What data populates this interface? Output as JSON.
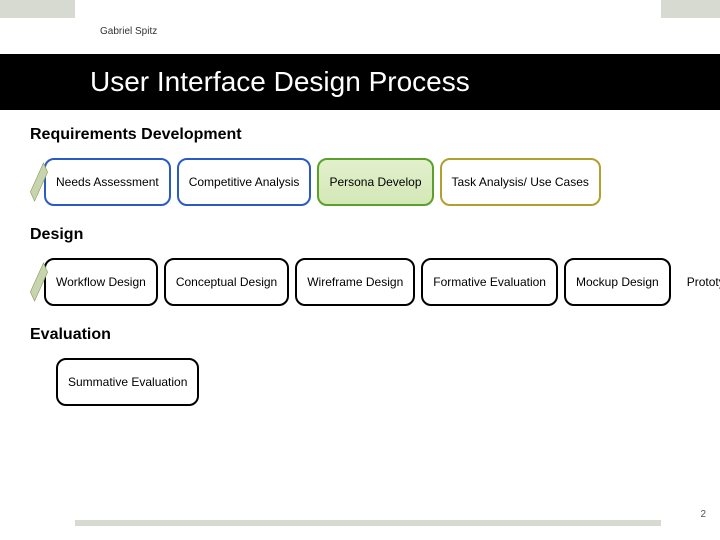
{
  "author": "Gabriel Spitz",
  "title": "User Interface Design Process",
  "page_number": "2",
  "sections": {
    "requirements": {
      "title": "Requirements Development",
      "steps": {
        "s1": "Needs Assessment",
        "s2": "Competitive Analysis",
        "s3": "Persona Develop",
        "s4": "Task Analysis/ Use Cases"
      }
    },
    "design": {
      "title": "Design",
      "steps": {
        "s1": "Workflow Design",
        "s2": "Conceptual Design",
        "s3": "Wireframe Design",
        "s4": "Formative Evaluation",
        "s5": "Mockup Design",
        "s6": "Prototype Design"
      }
    },
    "evaluation": {
      "title": "Evaluation",
      "steps": {
        "s1": "Summative Evaluation"
      }
    }
  }
}
